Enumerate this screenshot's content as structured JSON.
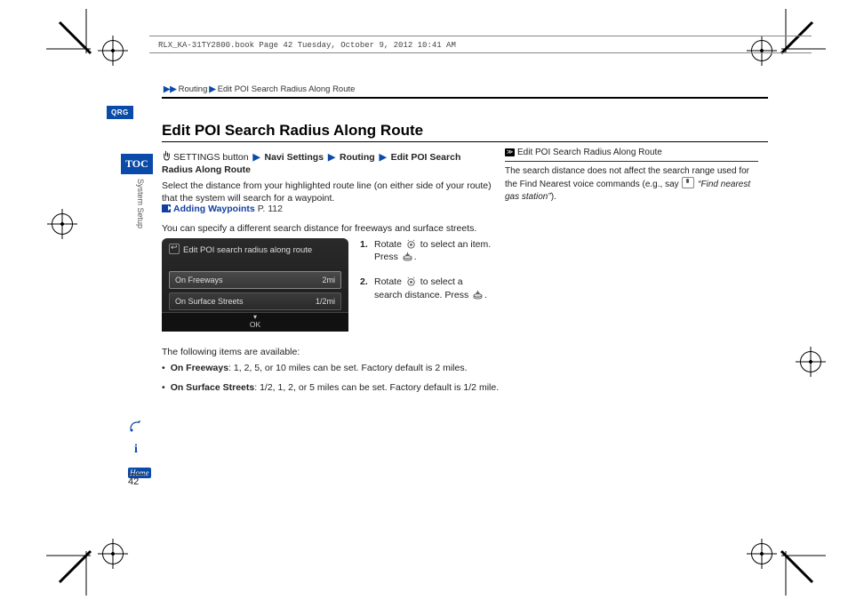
{
  "header_line": "RLX_KA-31TY2800.book  Page 42  Tuesday, October 9, 2012  10:41 AM",
  "breadcrumb": {
    "a": "Routing",
    "b": "Edit POI Search Radius Along Route"
  },
  "qrg": "QRG",
  "toc": "TOC",
  "side_label": "System Setup",
  "title": "Edit POI Search Radius Along Route",
  "path": {
    "p0": "SETTINGS button",
    "p1": "Navi Settings",
    "p2": "Routing",
    "p3": "Edit POI Search Radius Along Route"
  },
  "intro": "Select the distance from your highlighted route line (on either side of your route) that the system will search for a waypoint.",
  "link": {
    "label": "Adding Waypoints",
    "page": "P. 112"
  },
  "distance_note": "You can specify a different search distance for freeways and surface streets.",
  "shot": {
    "title": "Edit POI search radius along route",
    "row1_label": "On Freeways",
    "row1_value": "2mi",
    "row2_label": "On Surface Streets",
    "row2_value": "1/2mi",
    "ok": "OK"
  },
  "steps": {
    "s1a": "Rotate ",
    "s1b": " to select an item. Press ",
    "s1c": ".",
    "s2a": "Rotate ",
    "s2b": " to select a search distance. Press ",
    "s2c": "."
  },
  "following": "The following items are available:",
  "bullets": {
    "b1_label": "On Freeways",
    "b1_text": ": 1, 2, 5, or 10 miles can be set. Factory default is 2 miles.",
    "b2_label": "On Surface Streets",
    "b2_text": ": 1/2, 1, 2, or 5 miles can be set. Factory default is 1/2 mile."
  },
  "right": {
    "head": "Edit POI Search Radius Along Route",
    "body_a": "The search distance does not affect the search range used for the Find Nearest voice commands (e.g., say ",
    "body_quote": "“Find nearest gas station”",
    "body_b": ")."
  },
  "home_label": "Home",
  "page_number": "42"
}
